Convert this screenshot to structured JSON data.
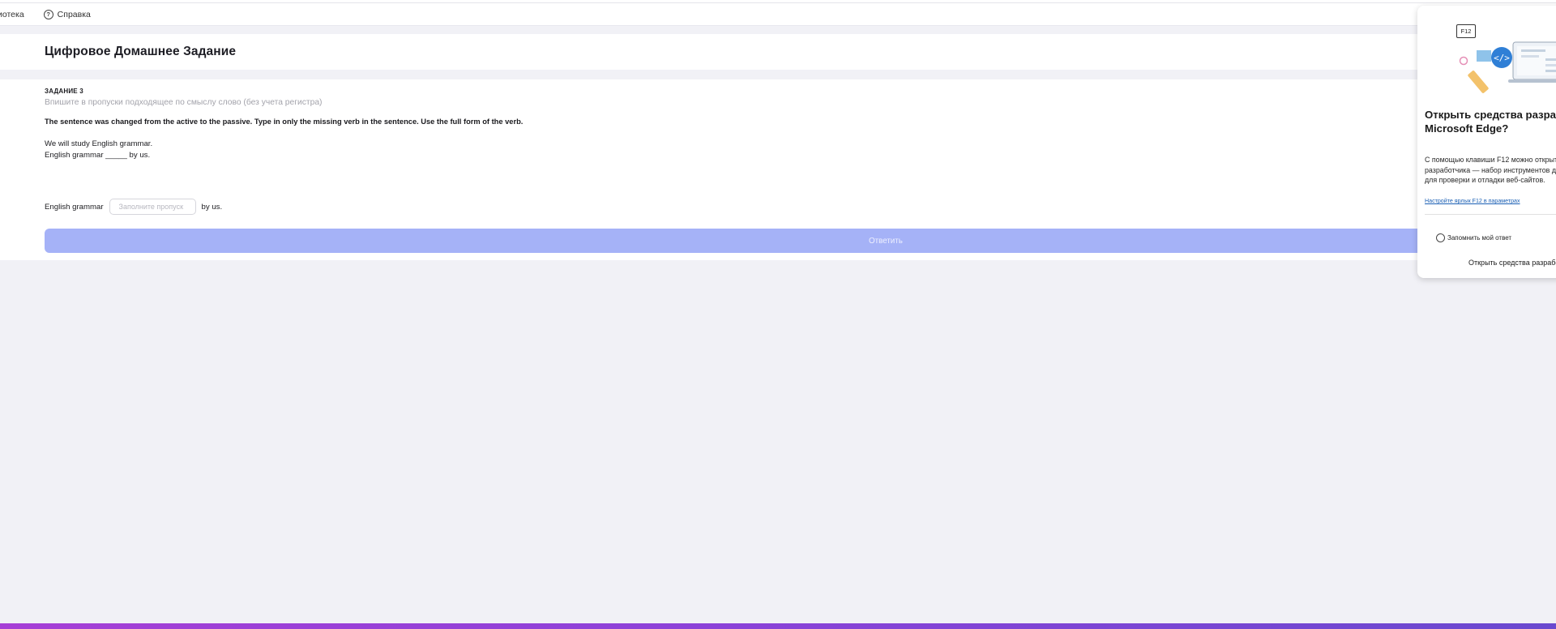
{
  "nav": {
    "items": [
      {
        "label": "иотека",
        "icon": ""
      },
      {
        "label": "Справка",
        "icon": "help-circle-icon"
      }
    ]
  },
  "page": {
    "title": "Цифровое Домашнее Задание"
  },
  "task": {
    "number": "ЗАДАНИЕ 3",
    "hint": "Впишите в пропуски подходящее по смыслу слово (без учета регистра)",
    "instruction": "The sentence was changed from the active to the passive. Type in only the missing verb in the sentence. Use the full form of the verb.",
    "example_active": "We will study English grammar.",
    "example_passive": "English grammar _____ by us.",
    "answer_prefix": "English grammar",
    "answer_placeholder": "Заполните пропуск",
    "answer_value": "",
    "answer_suffix": "by us.",
    "submit_label": "Ответить"
  },
  "edge_dialog": {
    "key_label": "F12",
    "title": "Открыть средства разрабо\nMicrosoft Edge?",
    "body": "С помощью клавиши F12 можно открыт\nразработчика — набор инструментов д\nдля проверки и отладки веб-сайтов.",
    "settings_link": "Настройте ярлык F12 в параметрах",
    "remember_label": "Запомнить мой ответ",
    "remember_checked": false,
    "open_button": "Открыть средства разрабо"
  },
  "colors": {
    "background": "#f1f1f6",
    "submit_button": "#a5b2f7",
    "bottom_gradient_start": "#a63fd6",
    "bottom_gradient_end": "#6a49cf",
    "link": "#1a5fb4"
  }
}
